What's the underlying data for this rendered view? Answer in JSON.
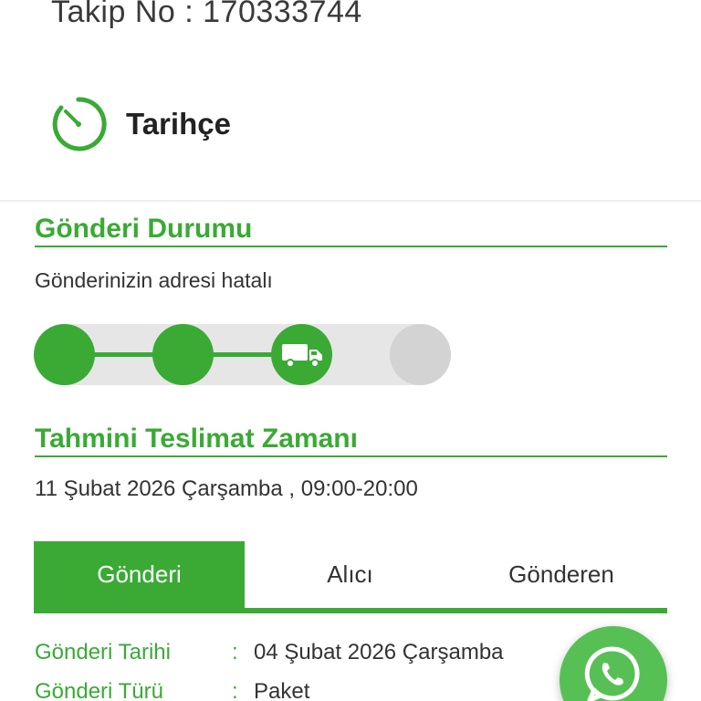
{
  "header": {
    "tracking_no": "Takip No : 170333744",
    "history_title": "Tarihçe"
  },
  "shipment_status": {
    "title": "Gönderi Durumu",
    "status_text": "Gönderinizin adresi hatalı",
    "progress": {
      "completed_steps": 3,
      "total_steps": 4,
      "current_step_icon": "truck-icon"
    }
  },
  "eta": {
    "title": "Tahmini Teslimat Zamanı",
    "value": "11 Şubat 2026 Çarşamba , 09:00-20:00"
  },
  "tabs": [
    {
      "label": "Gönderi",
      "active": true
    },
    {
      "label": "Alıcı",
      "active": false
    },
    {
      "label": "Gönderen",
      "active": false
    }
  ],
  "details": [
    {
      "label": "Gönderi Tarihi",
      "colon": ":",
      "value": "04 Şubat 2026 Çarşamba"
    },
    {
      "label": "Gönderi Türü",
      "colon": ":",
      "value": "Paket"
    }
  ],
  "colors": {
    "brand_green": "#3aaa35",
    "whatsapp_green": "#57c055",
    "inactive_gray": "#d3d3d3",
    "track_gray": "#e6e6e6"
  },
  "icons": {
    "history": "history-clock-icon",
    "whatsapp": "whatsapp-icon"
  }
}
